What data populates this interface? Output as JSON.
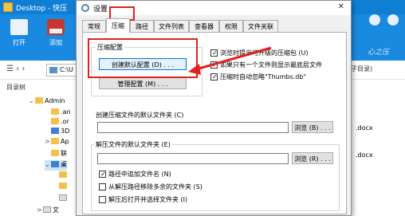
{
  "explorer": {
    "title": "Desktop - 快压",
    "ribbon": [
      {
        "label": "打开",
        "icon": "open-folder-icon"
      },
      {
        "label": "添加",
        "icon": "add-archive-icon"
      }
    ],
    "slogan": "心之压",
    "address_text": "C:\\U",
    "address_right": "子目录)",
    "tree_header": "目录树",
    "tree_items": [
      {
        "label": "Admin",
        "expand": "⌄",
        "icon": "folder"
      },
      {
        "label": ".an",
        "expand": "",
        "icon": "folder"
      },
      {
        "label": ".or",
        "expand": "",
        "icon": "folder"
      },
      {
        "label": "3D",
        "expand": "",
        "icon": "blue"
      },
      {
        "label": "Ap",
        "expand": ">",
        "icon": "folder"
      },
      {
        "label": "联",
        "expand": "",
        "icon": "folder"
      },
      {
        "label": "桌",
        "expand": "⌄",
        "icon": "blue"
      },
      {
        "label": "",
        "expand": "",
        "icon": "folder"
      },
      {
        "label": "",
        "expand": "",
        "icon": "folder"
      },
      {
        "label": "",
        "expand": "",
        "icon": "file"
      },
      {
        "label": "文",
        "expand": ">",
        "icon": "file"
      }
    ],
    "files": [
      ".docx",
      ".docx"
    ]
  },
  "dialog": {
    "title": "设置",
    "close_glyph": "✕",
    "tabs": [
      "常规",
      "压缩",
      "路径",
      "文件列表",
      "查看器",
      "权限",
      "文件关联"
    ],
    "active_tab": 1,
    "compress_group_label": "压缩配置",
    "create_default_btn": "创建默认配置 (D) . . .",
    "manage_btn": "管理配置 (M) . . .",
    "checkboxes_right": [
      {
        "label": "浏览时提示可升级的压缩包 (U)",
        "checked": true
      },
      {
        "label": "如果只有一个文件则显示最底层文件",
        "checked": true
      },
      {
        "label": "压缩时自动忽略\"Thumbs.db\"",
        "checked": true
      }
    ],
    "default_folder_label": "创建压缩文件的默认文件夹 (C)",
    "default_folder_value": "",
    "browse_btn_1": "浏览 (B) . . .",
    "extract_group_label": "解压文件的默认文件夹 (E)",
    "extract_folder_value": "",
    "browse_btn_2": "浏览 (R) . . .",
    "checkboxes_extract": [
      {
        "label": "路径中追加文件名 (N)",
        "checked": true
      },
      {
        "label": "从解压路径移除多余的文件夹 (S)",
        "checked": false
      },
      {
        "label": "解压后打开并选择文件夹 (I)",
        "checked": false
      }
    ]
  },
  "annotation_color": "#e0221c"
}
